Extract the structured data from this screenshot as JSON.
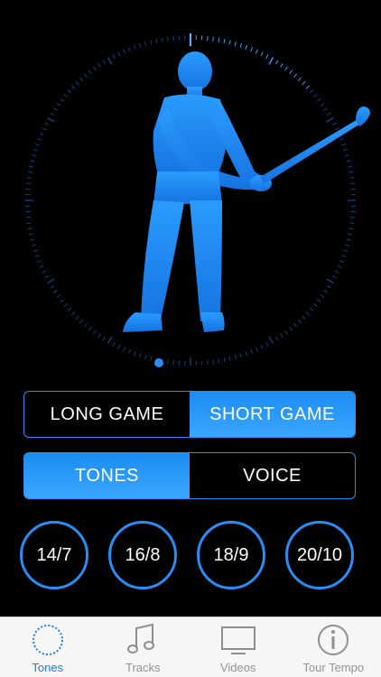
{
  "segments": {
    "game": {
      "options": [
        "LONG GAME",
        "SHORT GAME"
      ],
      "selected": "SHORT GAME"
    },
    "audio": {
      "options": [
        "TONES",
        "VOICE"
      ],
      "selected": "TONES"
    }
  },
  "presets": [
    "14/7",
    "16/8",
    "18/9",
    "20/10"
  ],
  "tabs": [
    {
      "label": "Tones",
      "icon": "dial-icon",
      "active": true
    },
    {
      "label": "Tracks",
      "icon": "music-note-icon",
      "active": false
    },
    {
      "label": "Videos",
      "icon": "tv-icon",
      "active": false
    },
    {
      "label": "Tour Tempo",
      "icon": "info-icon",
      "active": false
    }
  ],
  "colors": {
    "accent": "#2a8cf5",
    "silhouette": "#1e8cf0",
    "background": "#000000",
    "tab_active": "#1a7be8"
  }
}
